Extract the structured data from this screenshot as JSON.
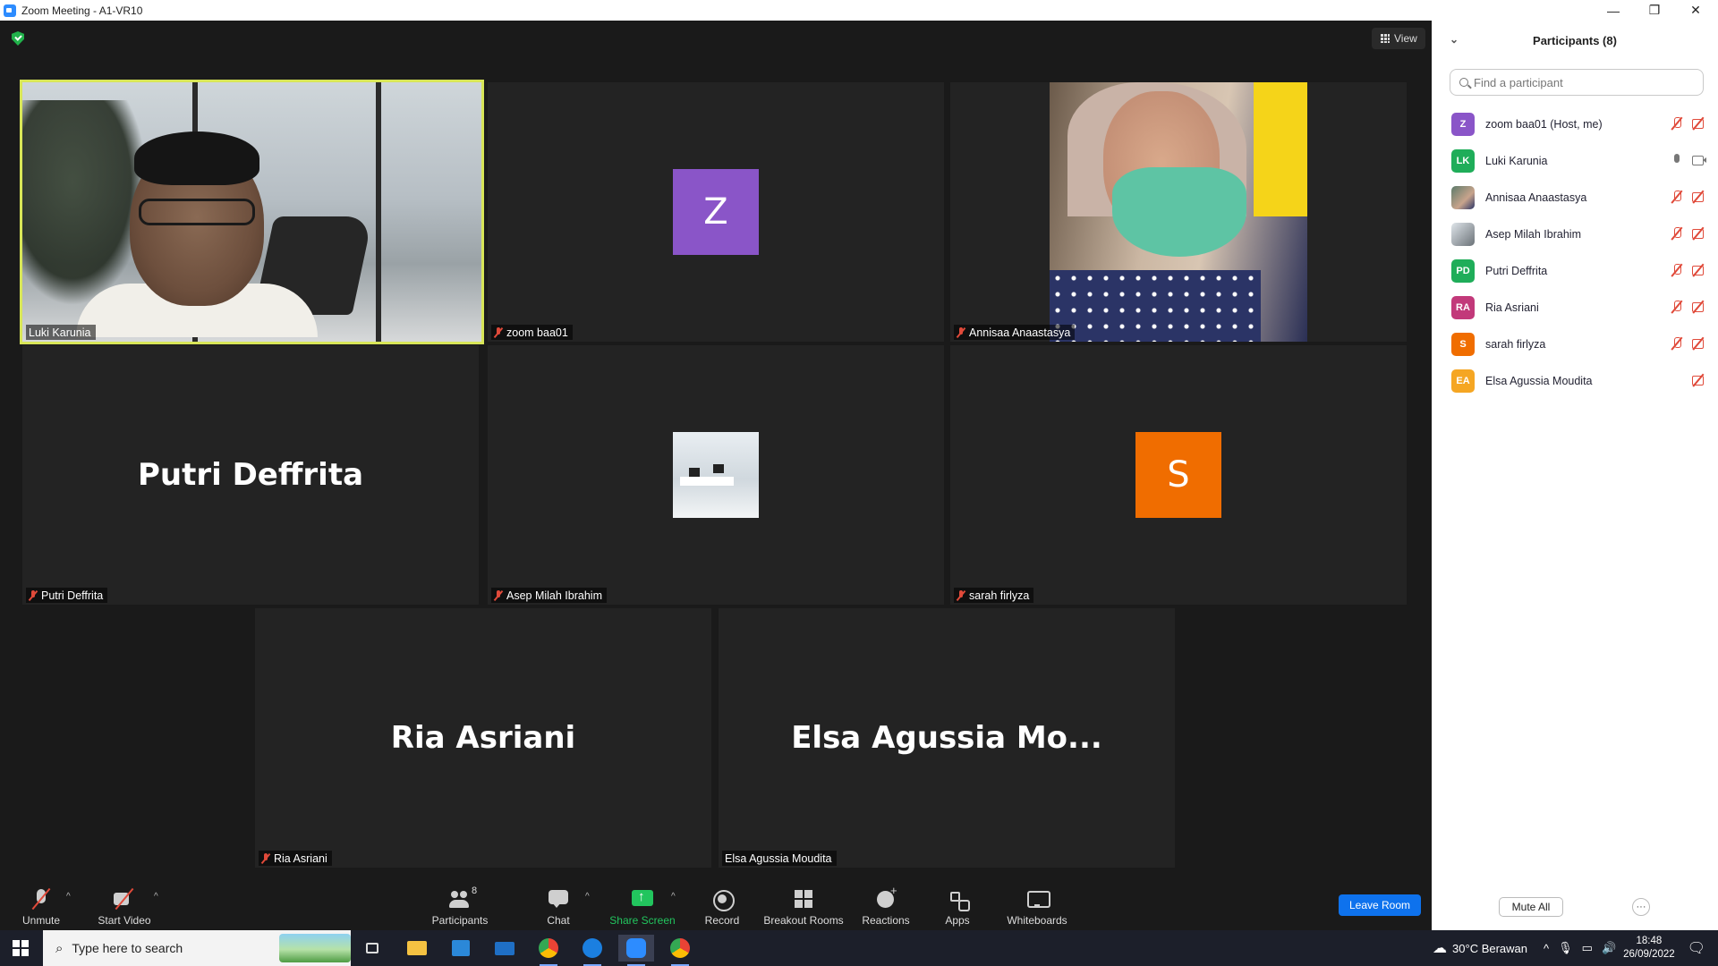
{
  "window": {
    "title": "Zoom Meeting - A1-VR10"
  },
  "meeting": {
    "view_label": "View",
    "tiles": [
      {
        "name": "Luki Karunia",
        "type": "video",
        "muted": false,
        "active_speaker": true
      },
      {
        "name": "zoom baa01",
        "type": "avatar",
        "initials": "Z",
        "color": "#8a55c8",
        "muted": true
      },
      {
        "name": "Annisaa Anaastasya",
        "type": "video",
        "muted": true
      },
      {
        "name": "Putri Deffrita",
        "type": "name",
        "display": "Putri Deffrita",
        "muted": true
      },
      {
        "name": "Asep Milah Ibrahim",
        "type": "photo",
        "muted": true
      },
      {
        "name": "sarah firlyza",
        "type": "avatar",
        "initials": "S",
        "color": "#f06d00",
        "muted": true
      },
      {
        "name": "Ria Asriani",
        "type": "name",
        "display": "Ria Asriani",
        "muted": true
      },
      {
        "name": "Elsa Agussia Moudita",
        "type": "name",
        "display": "Elsa Agussia Mo...",
        "muted": false
      }
    ]
  },
  "toolbar": {
    "unmute": "Unmute",
    "start_video": "Start Video",
    "participants": "Participants",
    "participants_count": "8",
    "chat": "Chat",
    "share_screen": "Share Screen",
    "record": "Record",
    "breakout_rooms": "Breakout Rooms",
    "reactions": "Reactions",
    "apps": "Apps",
    "whiteboards": "Whiteboards",
    "leave": "Leave Room"
  },
  "panel": {
    "title": "Participants (8)",
    "search_placeholder": "Find a participant",
    "participants": [
      {
        "name": "zoom baa01 (Host, me)",
        "initials": "Z",
        "color": "#8a55c8",
        "mic": "off",
        "cam": "off"
      },
      {
        "name": "Luki Karunia",
        "initials": "LK",
        "color": "#1fad59",
        "mic": "on",
        "cam": "on"
      },
      {
        "name": "Annisaa Anaastasya",
        "initials": "",
        "color": "#7c9a8a",
        "mic": "off",
        "cam": "off"
      },
      {
        "name": "Asep Milah Ibrahim",
        "initials": "",
        "color": "#8e949a",
        "mic": "off",
        "cam": "off"
      },
      {
        "name": "Putri Deffrita",
        "initials": "PD",
        "color": "#1fad59",
        "mic": "off",
        "cam": "off"
      },
      {
        "name": "Ria Asriani",
        "initials": "RA",
        "color": "#c2397a",
        "mic": "off",
        "cam": "off"
      },
      {
        "name": "sarah firlyza",
        "initials": "S",
        "color": "#f06d00",
        "mic": "off",
        "cam": "off"
      },
      {
        "name": "Elsa Agussia Moudita",
        "initials": "EA",
        "color": "#f5a623",
        "mic": "none",
        "cam": "off"
      }
    ],
    "mute_all": "Mute All",
    "more": "···"
  },
  "taskbar": {
    "search_placeholder": "Type here to search",
    "weather": "30°C  Berawan",
    "time": "18:48",
    "date": "26/09/2022"
  }
}
